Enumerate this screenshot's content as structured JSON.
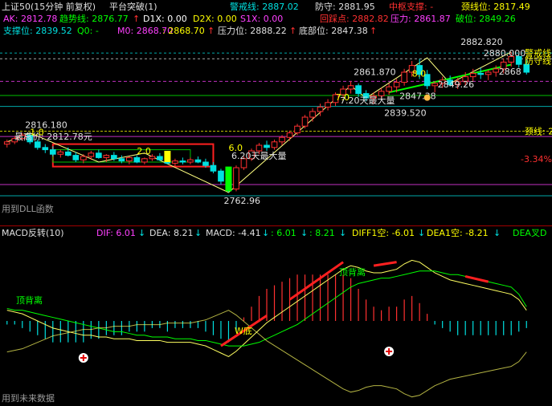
{
  "header": {
    "title": "上证50(15分钟 前复权)",
    "indicator_name": "平台突破(1)",
    "alert_line": {
      "label": "警戒线: 2887.02",
      "color": "#00e0e0"
    },
    "defense": {
      "label": "防守: 2881.95",
      "color": "#e0e0e0"
    },
    "mid_support": {
      "label": "中枢支撑: -",
      "color": "#ff3030"
    },
    "neckline_top": {
      "label": "颈线位: 2817.49",
      "color": "#ffff00"
    },
    "ak": {
      "label": "AK: 2812.78",
      "color": "#ff40ff"
    },
    "trend_line": {
      "label": "趋势线: 2876.77",
      "color": "#00ff00"
    },
    "d1x": {
      "label": "D1X: 0.00",
      "color": "#ffffff"
    },
    "d2x": {
      "label": "D2X: 0.00",
      "color": "#ffff00"
    },
    "s1x": {
      "label": "S1X: 0.00",
      "color": "#ff40ff"
    },
    "callback": {
      "label": "回踩点: 2882.82",
      "color": "#ff3030"
    },
    "pressure": {
      "label": "压力: 2861.87",
      "color": "#ff40ff"
    },
    "break_pos": {
      "label": "破位: 2849.26",
      "color": "#00ff00"
    },
    "support": {
      "label": "支撑位: 2839.52",
      "color": "#00e0e0"
    },
    "q0": {
      "label": "Q0: -",
      "color": "#00ff00"
    },
    "m0": {
      "label": "M0: 2868.70",
      "color": "#ff40ff"
    },
    "m0b": {
      "label": ": 2868.70",
      "color": "#ffff00"
    },
    "pressure_pos": {
      "label": "压力位: 2888.22",
      "color": "#e0e0e0"
    },
    "bottom_pos": {
      "label": "底部位: 2847.38",
      "color": "#e0e0e0"
    },
    "up_arrow": "↑"
  },
  "macd_header": {
    "name": "MACD反转(10)",
    "dif": {
      "label": "DIF: 6.01",
      "color": "#ff40ff"
    },
    "dea": {
      "label": "DEA: 8.21",
      "color": "#e0e0e0"
    },
    "macd": {
      "label": "MACD: -4.41",
      "color": "#e0e0e0"
    },
    "v1": {
      "label": ": 6.01",
      "color": "#00ff00"
    },
    "v2": {
      "label": ": 8.21",
      "color": "#00ff00"
    },
    "diff1": {
      "label": "DIFF1空: -6.01",
      "color": "#ffff00"
    },
    "dea1": {
      "label": "DEA1空: -8.21",
      "color": "#ffff00"
    },
    "dea_cross": {
      "label": "DEA叉D",
      "color": "#00ff00"
    },
    "down_arrow": "↓"
  },
  "labels": {
    "use_dll": "用到DLL函数",
    "use_future": "用到未来数据",
    "max_price": "最高价: 2812.78元",
    "vol_max1": "6.20天最大量",
    "vol_max2": "7.20天最大量",
    "neckline_right": "颈线: 2",
    "alert_right": "警戒线",
    "defense_right": "防守线",
    "pct": "-3.34%",
    "top_div1": "顶背离",
    "top_div2": "顶背离",
    "w_bottom": "W底",
    "num_6": "6.0",
    "num_7": "7.0",
    "num_8": "8.0",
    "num_2": "2.0",
    "num_1": "1.0"
  },
  "chart_data": [
    {
      "type": "candlestick",
      "title": "上证50(15分钟 前复权)",
      "price_annotations": [
        {
          "label": "2816.180",
          "value": 2816.18
        },
        {
          "label": "2762.96",
          "value": 2762.96
        },
        {
          "label": "2861.870",
          "value": 2861.87
        },
        {
          "label": "2839.520",
          "value": 2839.52
        },
        {
          "label": "2847.38",
          "value": 2847.38
        },
        {
          "label": "2849.26",
          "value": 2849.26
        },
        {
          "label": "2882.820",
          "value": 2882.82
        },
        {
          "label": "2880.000",
          "value": 2880.0
        },
        {
          "label": "2868",
          "value": 2868
        }
      ],
      "ohlc": [
        [
          2806,
          2810,
          2803,
          2808
        ],
        [
          2808,
          2813,
          2806,
          2811
        ],
        [
          2811,
          2816,
          2809,
          2814
        ],
        [
          2814,
          2816,
          2806,
          2808
        ],
        [
          2808,
          2810,
          2801,
          2803
        ],
        [
          2803,
          2806,
          2798,
          2801
        ],
        [
          2801,
          2804,
          2795,
          2797
        ],
        [
          2797,
          2801,
          2794,
          2799
        ],
        [
          2799,
          2803,
          2795,
          2796
        ],
        [
          2796,
          2799,
          2790,
          2792
        ],
        [
          2792,
          2797,
          2789,
          2795
        ],
        [
          2795,
          2800,
          2792,
          2798
        ],
        [
          2798,
          2801,
          2793,
          2794
        ],
        [
          2794,
          2797,
          2790,
          2796
        ],
        [
          2796,
          2799,
          2791,
          2793
        ],
        [
          2793,
          2796,
          2789,
          2791
        ],
        [
          2791,
          2795,
          2788,
          2794
        ],
        [
          2794,
          2796,
          2789,
          2790
        ],
        [
          2790,
          2794,
          2788,
          2793
        ],
        [
          2793,
          2797,
          2791,
          2795
        ],
        [
          2795,
          2798,
          2791,
          2792
        ],
        [
          2792,
          2795,
          2788,
          2789
        ],
        [
          2789,
          2793,
          2786,
          2791
        ],
        [
          2791,
          2794,
          2788,
          2790
        ],
        [
          2790,
          2794,
          2788,
          2792
        ],
        [
          2792,
          2795,
          2789,
          2790
        ],
        [
          2790,
          2793,
          2785,
          2787
        ],
        [
          2787,
          2790,
          2780,
          2782
        ],
        [
          2782,
          2784,
          2770,
          2773
        ],
        [
          2773,
          2776,
          2763,
          2766
        ],
        [
          2766,
          2787,
          2764,
          2785
        ],
        [
          2785,
          2795,
          2783,
          2793
        ],
        [
          2793,
          2802,
          2791,
          2800
        ],
        [
          2800,
          2807,
          2797,
          2805
        ],
        [
          2805,
          2809,
          2800,
          2803
        ],
        [
          2803,
          2810,
          2801,
          2808
        ],
        [
          2808,
          2814,
          2805,
          2812
        ],
        [
          2812,
          2818,
          2809,
          2816
        ],
        [
          2816,
          2824,
          2814,
          2822
        ],
        [
          2822,
          2832,
          2820,
          2830
        ],
        [
          2830,
          2838,
          2826,
          2835
        ],
        [
          2835,
          2842,
          2831,
          2839
        ],
        [
          2839,
          2846,
          2836,
          2843
        ],
        [
          2843,
          2852,
          2840,
          2850
        ],
        [
          2850,
          2858,
          2847,
          2855
        ],
        [
          2855,
          2862,
          2851,
          2858
        ],
        [
          2858,
          2860,
          2848,
          2851
        ],
        [
          2851,
          2854,
          2844,
          2847
        ],
        [
          2847,
          2852,
          2842,
          2849
        ],
        [
          2849,
          2856,
          2846,
          2853
        ],
        [
          2853,
          2860,
          2850,
          2857
        ],
        [
          2857,
          2864,
          2852,
          2861
        ],
        [
          2861,
          2873,
          2858,
          2870
        ],
        [
          2870,
          2880,
          2866,
          2876
        ],
        [
          2876,
          2882,
          2864,
          2868
        ],
        [
          2868,
          2872,
          2855,
          2858
        ],
        [
          2858,
          2862,
          2852,
          2860
        ],
        [
          2860,
          2866,
          2856,
          2863
        ],
        [
          2863,
          2867,
          2857,
          2859
        ],
        [
          2859,
          2865,
          2855,
          2862
        ],
        [
          2862,
          2870,
          2858,
          2866
        ],
        [
          2866,
          2873,
          2862,
          2869
        ],
        [
          2869,
          2874,
          2864,
          2868
        ],
        [
          2868,
          2872,
          2863,
          2870
        ],
        [
          2870,
          2876,
          2866,
          2873
        ],
        [
          2873,
          2882,
          2869,
          2879
        ],
        [
          2879,
          2888,
          2875,
          2884
        ],
        [
          2884,
          2887,
          2874,
          2877
        ],
        [
          2877,
          2881,
          2868,
          2870
        ]
      ]
    },
    {
      "type": "bar",
      "title": "MACD反转(10)",
      "series": [
        {
          "name": "DIF",
          "values": [
            6,
            5,
            4,
            2,
            0,
            -2,
            -4,
            -5,
            -6,
            -7,
            -8,
            -8,
            -9,
            -9,
            -10,
            -10,
            -10,
            -11,
            -11,
            -11,
            -11,
            -12,
            -12,
            -12,
            -12,
            -13,
            -14,
            -16,
            -18,
            -20,
            -17,
            -13,
            -9,
            -5,
            -1,
            2,
            5,
            8,
            11,
            14,
            17,
            20,
            23,
            26,
            29,
            31,
            30,
            28,
            27,
            27,
            28,
            29,
            32,
            34,
            33,
            30,
            27,
            25,
            23,
            22,
            21,
            20,
            19,
            18,
            17,
            16,
            15,
            12,
            6
          ]
        },
        {
          "name": "DEA",
          "values": [
            7,
            6,
            6,
            5,
            4,
            3,
            2,
            1,
            0,
            -1,
            -2,
            -3,
            -4,
            -5,
            -6,
            -6,
            -7,
            -8,
            -8,
            -9,
            -9,
            -9,
            -10,
            -10,
            -10,
            -11,
            -11,
            -12,
            -13,
            -14,
            -14,
            -14,
            -13,
            -12,
            -10,
            -8,
            -6,
            -4,
            -2,
            1,
            4,
            7,
            10,
            13,
            16,
            19,
            21,
            22,
            23,
            24,
            24,
            25,
            26,
            27,
            28,
            28,
            28,
            27,
            26,
            26,
            25,
            24,
            23,
            22,
            21,
            20,
            19,
            15,
            8
          ]
        }
      ],
      "hist_note": "MACD"
    }
  ]
}
